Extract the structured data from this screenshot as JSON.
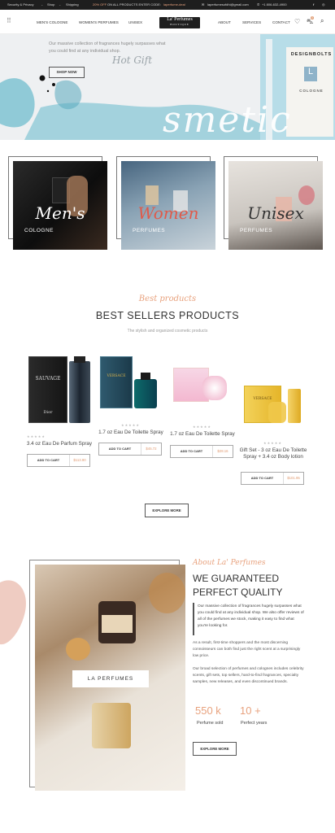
{
  "topbar": {
    "link_security": "Security & Privacy",
    "link_shop": "Shop",
    "link_shipping": "Shipping",
    "promo_prefix": "20% OFF",
    "promo_middle": "ON ALL PRODUCTS ENTER CODE:",
    "promo_code": "laperfume-deal",
    "email": "laperfumesofdhi@gmail.com",
    "phone": "+1 806-632-4900"
  },
  "nav": {
    "mens": "MEN'S COLOGNE",
    "womens": "WOMEN'S PERFUMES",
    "unisex": "UNISEX",
    "logo_main": "La' Perfumes",
    "logo_sub": "BOUTIQUE",
    "about": "ABOUT",
    "services": "SERVICES",
    "contact": "CONTACT",
    "cart_count": "0"
  },
  "hero": {
    "tagline": "Our massive collection of fragrances hugely surpasses what you could find at any individual shop.",
    "script": "Hot Gift",
    "shop_now": "SHOP NOW",
    "big_word": "smetic",
    "box_brand": "DESIGNBOLTS",
    "box_letter": "L",
    "box_sub": "COLOGNE"
  },
  "categories": [
    {
      "script": "Men's",
      "label": "COLOGNE"
    },
    {
      "script": "Women",
      "label": "PERFUMES"
    },
    {
      "script": "Unisex",
      "label": "PERFUMES"
    }
  ],
  "bestsellers": {
    "script": "Best products",
    "title": "BEST SELLERS PRODUCTS",
    "subtitle": "The stylish and organized cosmetic products",
    "explore": "EXPLORE MORE"
  },
  "products": [
    {
      "name": "3.4 oz Eau De Parfum Spray",
      "price": "$113.90",
      "cart": "ADD TO CART",
      "brand": "SAUVAGE",
      "maker": "Dior"
    },
    {
      "name": "1.7 oz Eau De Toilette Spray",
      "price": "$45.72",
      "cart": "ADD TO CART",
      "brand": "VERSACE"
    },
    {
      "name": "1.7 oz Eau De Toilette Spray",
      "price": "$28.16",
      "cart": "ADD TO CART"
    },
    {
      "name": "Gift Set - 3 oz Eau De Toilette Spray + 3.4 oz Body lotion",
      "price": "$101.95",
      "cart": "ADD TO CART",
      "brand": "VERSACE"
    }
  ],
  "about": {
    "script": "About La' Perfumes",
    "title_line1": "WE GUARANTEED",
    "title_line2": "PERFECT QUALITY",
    "quote": "Our massive collection of fragrances hugely surpasses what you could find at any individual shop. We also offer reviews of all of the perfumes we stock, making it easy to find what you're looking for.",
    "para1": "As a result, first-time shoppers and the most discerning connoisseurs can both find just the right scent at a surprisingly low price.",
    "para2": "Our broad selection of perfumes and colognes includes celebrity scents, gift sets, top sellers, hard-to-find fragrances, specialty samples, new releases, and even discontinued brands.",
    "stat1_value": "550 k",
    "stat1_label": "Perfume sold",
    "stat2_value": "10 +",
    "stat2_label": "Perfect years",
    "explore": "EXPLORE MORE",
    "badge": "LA PERFUMES"
  }
}
